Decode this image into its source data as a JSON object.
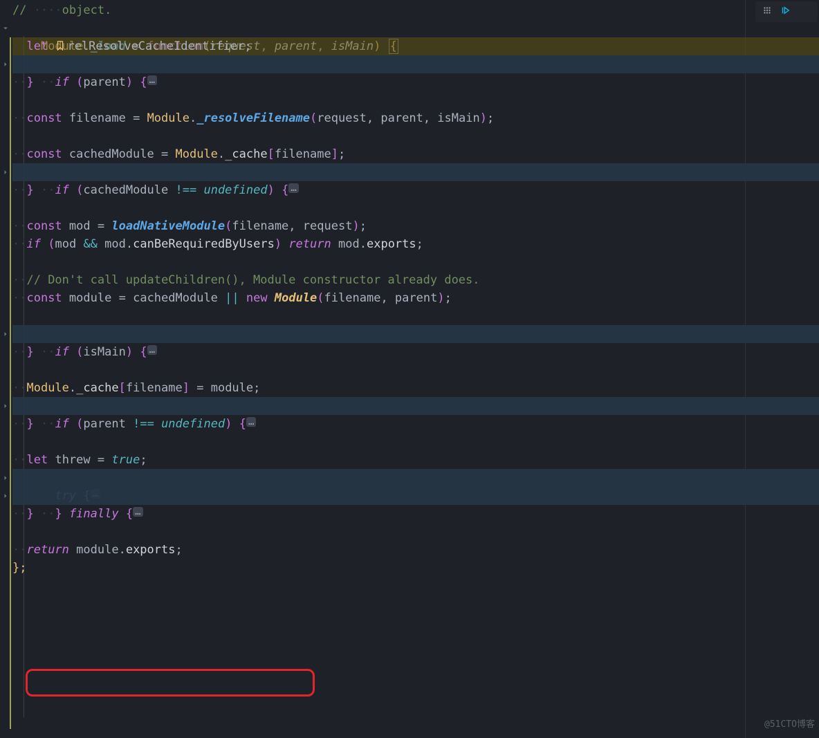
{
  "lines": {
    "l1_comment1": "// ",
    "l1_comment2": "object.",
    "l2": {
      "cls": "Module",
      "dot": ".",
      "fn": "_load",
      "eq": " = ",
      "kw": "function",
      "params": [
        "request",
        "parent",
        "isMain"
      ]
    },
    "l3": {
      "kw": "let",
      "ident": "relResolveCacheIdentifier"
    },
    "l4": {
      "kw": "if",
      "expr": "parent"
    },
    "l5": "}",
    "l7": {
      "kw": "const",
      "name": "filename",
      "cls": "Module",
      "fn": "_resolveFilename",
      "args": [
        "request",
        "parent",
        "isMain"
      ]
    },
    "l9": {
      "kw": "const",
      "name": "cachedModule",
      "cls": "Module",
      "prop": "_cache",
      "idx": "filename"
    },
    "l10": {
      "kw": "if",
      "v": "cachedModule",
      "op": "!==",
      "c": "undefined"
    },
    "l11": "}",
    "l13": {
      "kw": "const",
      "name": "mod",
      "fn": "loadNativeModule",
      "args": [
        "filename",
        "request"
      ]
    },
    "l14": {
      "kw": "if",
      "v1": "mod",
      "op": "&&",
      "v2": "mod",
      "p": "canBeRequiredByUsers",
      "ret": "return",
      "rv": "mod",
      "rp": "exports"
    },
    "l16_comment": "// Don't call updateChildren(), Module constructor already does.",
    "l17": {
      "kw": "const",
      "name": "module",
      "v": "cachedModule",
      "op": "||",
      "new": "new",
      "cls": "Module",
      "args": [
        "filename",
        "parent"
      ]
    },
    "l19": {
      "kw": "if",
      "expr": "isMain"
    },
    "l20": "}",
    "l22": {
      "cls": "Module",
      "prop": "_cache",
      "idx": "filename",
      "v": "module"
    },
    "l23": {
      "kw": "if",
      "v": "parent",
      "op": "!==",
      "c": "undefined"
    },
    "l24": "}",
    "l26": {
      "kw": "let",
      "name": "threw",
      "c": "true"
    },
    "l27": {
      "kw": "try"
    },
    "l28": {
      "kw": "finally"
    },
    "l29": "}",
    "l31": {
      "kw": "return",
      "v": "module",
      "p": "exports"
    },
    "l32": "};"
  },
  "ellipsis": "…",
  "watermark": "@51CTO博客",
  "toolbar": {
    "grip": "grip",
    "play": "play"
  }
}
